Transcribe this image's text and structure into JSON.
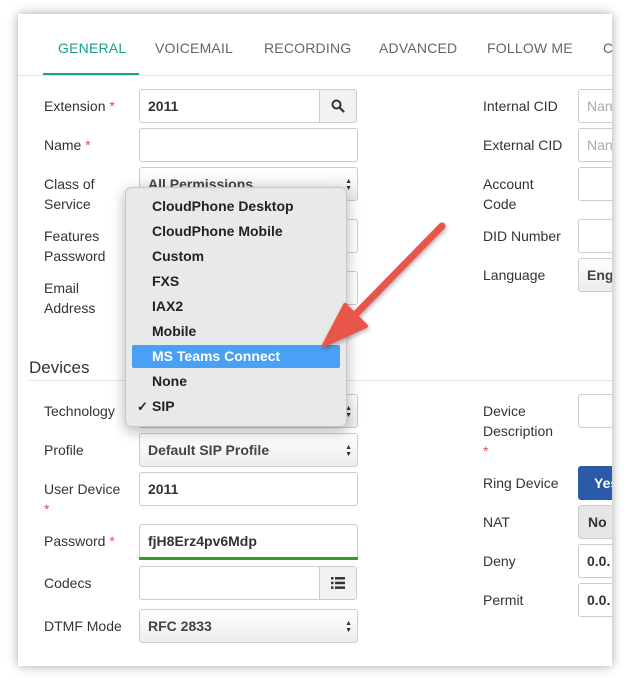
{
  "tabs": [
    {
      "label": "GENERAL",
      "active": true
    },
    {
      "label": "VOICEMAIL"
    },
    {
      "label": "RECORDING"
    },
    {
      "label": "ADVANCED"
    },
    {
      "label": "FOLLOW ME"
    },
    {
      "label": "C"
    }
  ],
  "general": {
    "extension_label": "Extension",
    "extension_value": "2011",
    "name_label": "Name",
    "name_value": "",
    "class_label_1": "Class of",
    "class_label_2": "Service",
    "class_value": "All Permissions",
    "features_label_1": "Features",
    "features_label_2": "Password",
    "email_label_1": "Email",
    "email_label_2": "Address",
    "required_mark": "*"
  },
  "right_col": {
    "internal_cid_label": "Internal CID",
    "internal_cid_placeholder": "Nan",
    "external_cid_label": "External CID",
    "external_cid_placeholder": "Nan",
    "account_code_label_1": "Account",
    "account_code_label_2": "Code",
    "did_label": "DID Number",
    "language_label": "Language",
    "language_value": "Eng"
  },
  "devices": {
    "section_title": "Devices",
    "technology_label": "Technology",
    "profile_label": "Profile",
    "profile_value": "Default SIP Profile",
    "user_device_label": "User Device",
    "user_device_value": "2011",
    "password_label": "Password",
    "password_value": "fjH8Erz4pv6Mdp",
    "codecs_label": "Codecs",
    "dtmf_label": "DTMF Mode",
    "dtmf_value": "RFC 2833",
    "device_desc_label_1": "Device",
    "device_desc_label_2": "Description",
    "ring_device_label": "Ring Device",
    "ring_device_value": "Yes",
    "nat_label": "NAT",
    "nat_value": "No",
    "deny_label": "Deny",
    "deny_value": "0.0.",
    "permit_label": "Permit",
    "permit_value": "0.0."
  },
  "technology_dropdown": {
    "options": [
      {
        "label": "CloudPhone Desktop"
      },
      {
        "label": "CloudPhone Mobile"
      },
      {
        "label": "Custom"
      },
      {
        "label": "FXS"
      },
      {
        "label": "IAX2"
      },
      {
        "label": "Mobile"
      },
      {
        "label": "MS Teams Connect",
        "highlighted": true
      },
      {
        "label": "None"
      },
      {
        "label": "SIP",
        "selected": true
      }
    ],
    "check_mark": "✓"
  },
  "colors": {
    "accent": "#19a08a",
    "highlight": "#4aa0f5",
    "annotation_arrow": "#e8574a",
    "primary_button": "#2b5aa8"
  }
}
